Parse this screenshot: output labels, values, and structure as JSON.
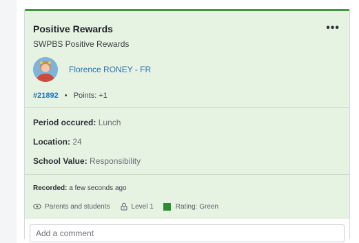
{
  "card": {
    "title": "Positive Rewards",
    "subtitle": "SWPBS Positive Rewards",
    "more_label": "•••",
    "user": {
      "name": "Florence RONEY - FR"
    },
    "meta": {
      "id": "#21892",
      "separator": "•",
      "points": "Points: +1"
    },
    "fields": [
      {
        "key": "Period occured:",
        "value": "Lunch"
      },
      {
        "key": "Location:",
        "value": "24"
      },
      {
        "key": "School Value:",
        "value": "Responsibility"
      }
    ],
    "recorded": {
      "key": "Recorded:",
      "value": "a few seconds ago"
    },
    "tags": {
      "visibility": "Parents and students",
      "level": "Level 1",
      "rating": "Rating: Green"
    },
    "accent_color": "#3c9a3e",
    "rating_color": "#2e8b2f"
  },
  "comment": {
    "placeholder": "Add a comment"
  }
}
